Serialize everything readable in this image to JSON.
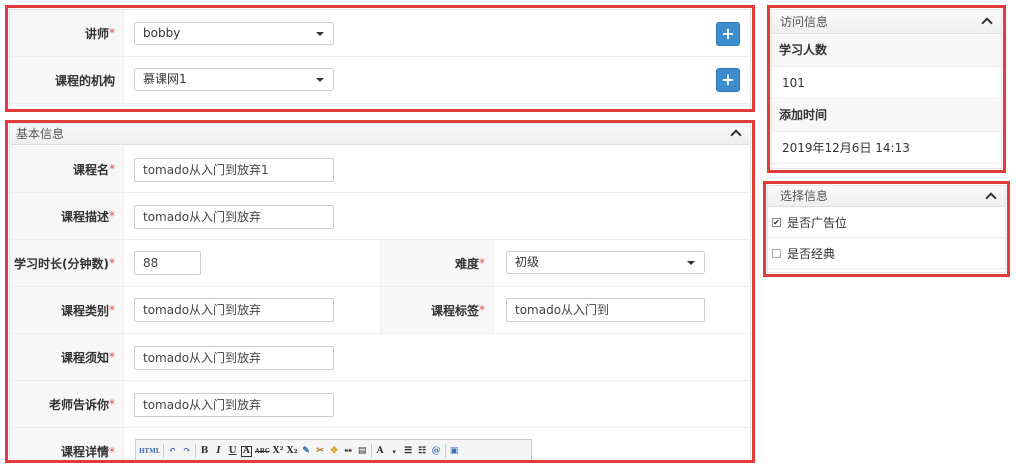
{
  "top_form": {
    "teacher": {
      "label": "讲师",
      "required_mark": "*",
      "value": "bobby",
      "add_label": "+"
    },
    "org": {
      "label": "课程的机构",
      "value": "慕课网1",
      "add_label": "+"
    }
  },
  "basic_info": {
    "title": "基本信息",
    "fields": {
      "name": {
        "label": "课程名",
        "value": "tomado从入门到放弃1"
      },
      "desc": {
        "label": "课程描述",
        "value": "tomado从入门到放弃"
      },
      "duration": {
        "label": "学习时长(分钟数)",
        "value": "88"
      },
      "difficulty": {
        "label": "难度",
        "value": "初级"
      },
      "category": {
        "label": "课程类别",
        "value": "tomado从入门到放弃"
      },
      "tag": {
        "label": "课程标签",
        "value": "tomado从入门到"
      },
      "notice": {
        "label": "课程须知",
        "value": "tomado从入门到放弃"
      },
      "teacher_tell": {
        "label": "老师告诉你",
        "value": "tomado从入门到放弃"
      },
      "detail": {
        "label": "课程详情"
      }
    },
    "required_mark": "*",
    "toolbar": [
      "HTML",
      "↶",
      "↷",
      "B",
      "I",
      "U",
      "A",
      "ABC",
      "X²",
      "X₂",
      "✎",
      "✂",
      "✥",
      "❝❝",
      "▤",
      "A",
      "▾",
      "☰",
      "☷",
      "@",
      "▣"
    ]
  },
  "visit_info": {
    "title": "访问信息",
    "students_label": "学习人数",
    "students_value": "101",
    "added_label": "添加时间",
    "added_value": "2019年12月6日 14:13"
  },
  "select_info": {
    "title": "选择信息",
    "options": [
      {
        "label": "是否广告位",
        "checked": true,
        "mark": "✔"
      },
      {
        "label": "是否经典",
        "checked": false,
        "mark": ""
      }
    ]
  }
}
